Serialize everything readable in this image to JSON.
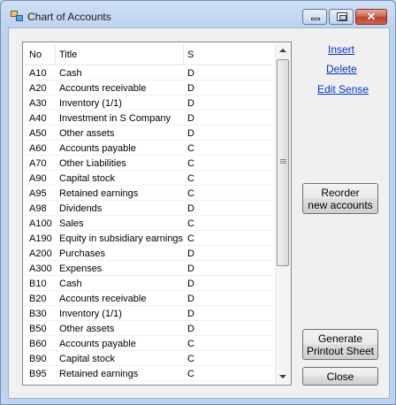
{
  "window": {
    "title": "Chart of Accounts"
  },
  "icons": {
    "app": "app-icon",
    "minimize": "minimize-icon",
    "maximize": "maximize-icon",
    "close": "close-icon"
  },
  "close_glyph": "✕",
  "table": {
    "headers": {
      "no": "No",
      "title": "Title",
      "sense": "S"
    },
    "rows": [
      {
        "no": "A10",
        "title": "Cash",
        "sense": "D"
      },
      {
        "no": "A20",
        "title": "Accounts receivable",
        "sense": "D"
      },
      {
        "no": "A30",
        "title": "Inventory (1/1)",
        "sense": "D"
      },
      {
        "no": "A40",
        "title": "Investment in S Company",
        "sense": "D"
      },
      {
        "no": "A50",
        "title": "Other assets",
        "sense": "D"
      },
      {
        "no": "A60",
        "title": "Accounts payable",
        "sense": "C"
      },
      {
        "no": "A70",
        "title": "Other Liabilities",
        "sense": "C"
      },
      {
        "no": "A90",
        "title": "Capital stock",
        "sense": "C"
      },
      {
        "no": "A95",
        "title": "Retained earnings",
        "sense": "C"
      },
      {
        "no": "A98",
        "title": "Dividends",
        "sense": "D"
      },
      {
        "no": "A100",
        "title": "Sales",
        "sense": "C"
      },
      {
        "no": "A190",
        "title": "Equity in subsidiary earnings",
        "sense": "C"
      },
      {
        "no": "A200",
        "title": "Purchases",
        "sense": "D"
      },
      {
        "no": "A300",
        "title": "Expenses",
        "sense": "D"
      },
      {
        "no": "B10",
        "title": "Cash",
        "sense": "D"
      },
      {
        "no": "B20",
        "title": "Accounts receivable",
        "sense": "D"
      },
      {
        "no": "B30",
        "title": "Inventory (1/1)",
        "sense": "D"
      },
      {
        "no": "B50",
        "title": "Other assets",
        "sense": "D"
      },
      {
        "no": "B60",
        "title": "Accounts payable",
        "sense": "C"
      },
      {
        "no": "B90",
        "title": "Capital stock",
        "sense": "C"
      },
      {
        "no": "B95",
        "title": "Retained earnings",
        "sense": "C"
      }
    ]
  },
  "links": {
    "insert": "Insert",
    "delete": "Delete",
    "edit_sense": "Edit Sense"
  },
  "buttons": {
    "reorder_line1": "Reorder",
    "reorder_line2": "new accounts",
    "generate_line1": "Generate",
    "generate_line2": "Printout Sheet",
    "close": "Close"
  }
}
